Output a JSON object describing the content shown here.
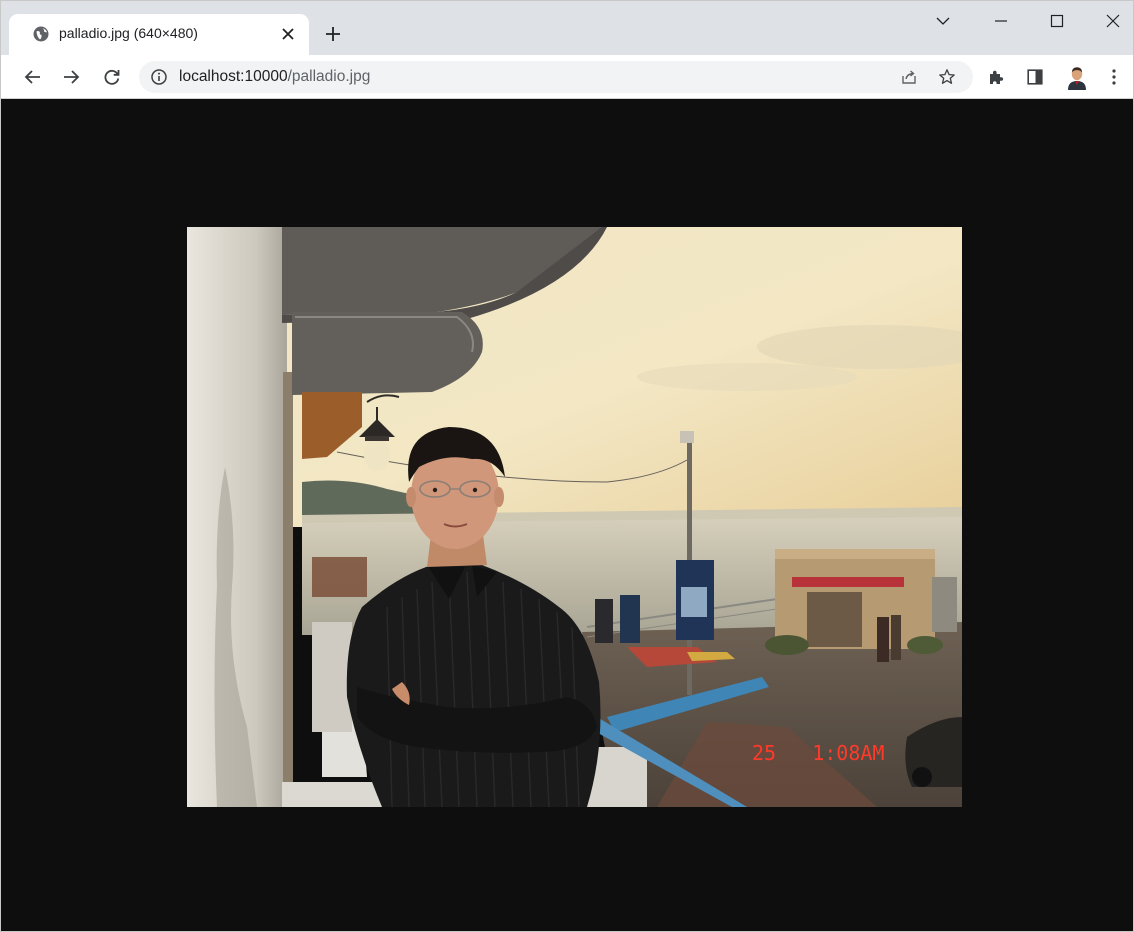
{
  "tab": {
    "title": "palladio.jpg (640×480)",
    "favicon": "globe-icon",
    "close_glyph": "✕"
  },
  "new_tab_glyph": "+",
  "window_controls": {
    "tab_search": "chevron-down-icon",
    "minimize": "minimize-icon",
    "maximize": "maximize-icon",
    "close": "close-icon"
  },
  "toolbar": {
    "back": "back-arrow-icon",
    "forward": "forward-arrow-icon",
    "reload": "reload-icon",
    "url_host": "localhost:10000",
    "url_path": "/palladio.jpg",
    "share": "share-icon",
    "bookmark": "star-icon",
    "extensions": "puzzle-icon",
    "side_panel": "side-panel-icon",
    "profile": "avatar",
    "menu": "kebab-menu-icon"
  },
  "photo": {
    "date_stamp": "25   1:08AM",
    "stamp_color": "#ff3a2a"
  }
}
